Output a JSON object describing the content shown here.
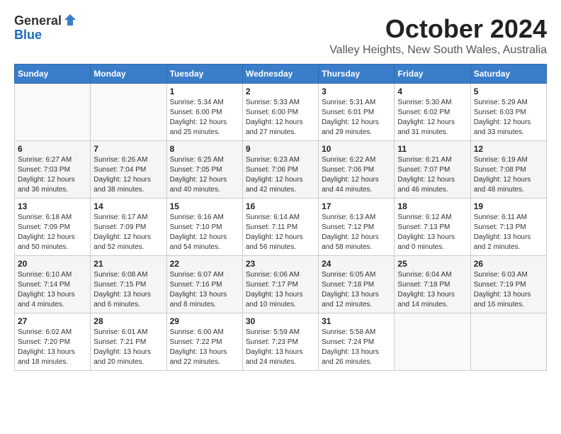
{
  "logo": {
    "line1": "General",
    "line2": "Blue"
  },
  "title": "October 2024",
  "location": "Valley Heights, New South Wales, Australia",
  "days_of_week": [
    "Sunday",
    "Monday",
    "Tuesday",
    "Wednesday",
    "Thursday",
    "Friday",
    "Saturday"
  ],
  "weeks": [
    [
      {
        "day": "",
        "info": ""
      },
      {
        "day": "",
        "info": ""
      },
      {
        "day": "1",
        "info": "Sunrise: 5:34 AM\nSunset: 6:00 PM\nDaylight: 12 hours\nand 25 minutes."
      },
      {
        "day": "2",
        "info": "Sunrise: 5:33 AM\nSunset: 6:00 PM\nDaylight: 12 hours\nand 27 minutes."
      },
      {
        "day": "3",
        "info": "Sunrise: 5:31 AM\nSunset: 6:01 PM\nDaylight: 12 hours\nand 29 minutes."
      },
      {
        "day": "4",
        "info": "Sunrise: 5:30 AM\nSunset: 6:02 PM\nDaylight: 12 hours\nand 31 minutes."
      },
      {
        "day": "5",
        "info": "Sunrise: 5:29 AM\nSunset: 6:03 PM\nDaylight: 12 hours\nand 33 minutes."
      }
    ],
    [
      {
        "day": "6",
        "info": "Sunrise: 6:27 AM\nSunset: 7:03 PM\nDaylight: 12 hours\nand 36 minutes."
      },
      {
        "day": "7",
        "info": "Sunrise: 6:26 AM\nSunset: 7:04 PM\nDaylight: 12 hours\nand 38 minutes."
      },
      {
        "day": "8",
        "info": "Sunrise: 6:25 AM\nSunset: 7:05 PM\nDaylight: 12 hours\nand 40 minutes."
      },
      {
        "day": "9",
        "info": "Sunrise: 6:23 AM\nSunset: 7:06 PM\nDaylight: 12 hours\nand 42 minutes."
      },
      {
        "day": "10",
        "info": "Sunrise: 6:22 AM\nSunset: 7:06 PM\nDaylight: 12 hours\nand 44 minutes."
      },
      {
        "day": "11",
        "info": "Sunrise: 6:21 AM\nSunset: 7:07 PM\nDaylight: 12 hours\nand 46 minutes."
      },
      {
        "day": "12",
        "info": "Sunrise: 6:19 AM\nSunset: 7:08 PM\nDaylight: 12 hours\nand 48 minutes."
      }
    ],
    [
      {
        "day": "13",
        "info": "Sunrise: 6:18 AM\nSunset: 7:09 PM\nDaylight: 12 hours\nand 50 minutes."
      },
      {
        "day": "14",
        "info": "Sunrise: 6:17 AM\nSunset: 7:09 PM\nDaylight: 12 hours\nand 52 minutes."
      },
      {
        "day": "15",
        "info": "Sunrise: 6:16 AM\nSunset: 7:10 PM\nDaylight: 12 hours\nand 54 minutes."
      },
      {
        "day": "16",
        "info": "Sunrise: 6:14 AM\nSunset: 7:11 PM\nDaylight: 12 hours\nand 56 minutes."
      },
      {
        "day": "17",
        "info": "Sunrise: 6:13 AM\nSunset: 7:12 PM\nDaylight: 12 hours\nand 58 minutes."
      },
      {
        "day": "18",
        "info": "Sunrise: 6:12 AM\nSunset: 7:13 PM\nDaylight: 13 hours\nand 0 minutes."
      },
      {
        "day": "19",
        "info": "Sunrise: 6:11 AM\nSunset: 7:13 PM\nDaylight: 13 hours\nand 2 minutes."
      }
    ],
    [
      {
        "day": "20",
        "info": "Sunrise: 6:10 AM\nSunset: 7:14 PM\nDaylight: 13 hours\nand 4 minutes."
      },
      {
        "day": "21",
        "info": "Sunrise: 6:08 AM\nSunset: 7:15 PM\nDaylight: 13 hours\nand 6 minutes."
      },
      {
        "day": "22",
        "info": "Sunrise: 6:07 AM\nSunset: 7:16 PM\nDaylight: 13 hours\nand 8 minutes."
      },
      {
        "day": "23",
        "info": "Sunrise: 6:06 AM\nSunset: 7:17 PM\nDaylight: 13 hours\nand 10 minutes."
      },
      {
        "day": "24",
        "info": "Sunrise: 6:05 AM\nSunset: 7:18 PM\nDaylight: 13 hours\nand 12 minutes."
      },
      {
        "day": "25",
        "info": "Sunrise: 6:04 AM\nSunset: 7:18 PM\nDaylight: 13 hours\nand 14 minutes."
      },
      {
        "day": "26",
        "info": "Sunrise: 6:03 AM\nSunset: 7:19 PM\nDaylight: 13 hours\nand 16 minutes."
      }
    ],
    [
      {
        "day": "27",
        "info": "Sunrise: 6:02 AM\nSunset: 7:20 PM\nDaylight: 13 hours\nand 18 minutes."
      },
      {
        "day": "28",
        "info": "Sunrise: 6:01 AM\nSunset: 7:21 PM\nDaylight: 13 hours\nand 20 minutes."
      },
      {
        "day": "29",
        "info": "Sunrise: 6:00 AM\nSunset: 7:22 PM\nDaylight: 13 hours\nand 22 minutes."
      },
      {
        "day": "30",
        "info": "Sunrise: 5:59 AM\nSunset: 7:23 PM\nDaylight: 13 hours\nand 24 minutes."
      },
      {
        "day": "31",
        "info": "Sunrise: 5:58 AM\nSunset: 7:24 PM\nDaylight: 13 hours\nand 26 minutes."
      },
      {
        "day": "",
        "info": ""
      },
      {
        "day": "",
        "info": ""
      }
    ]
  ]
}
